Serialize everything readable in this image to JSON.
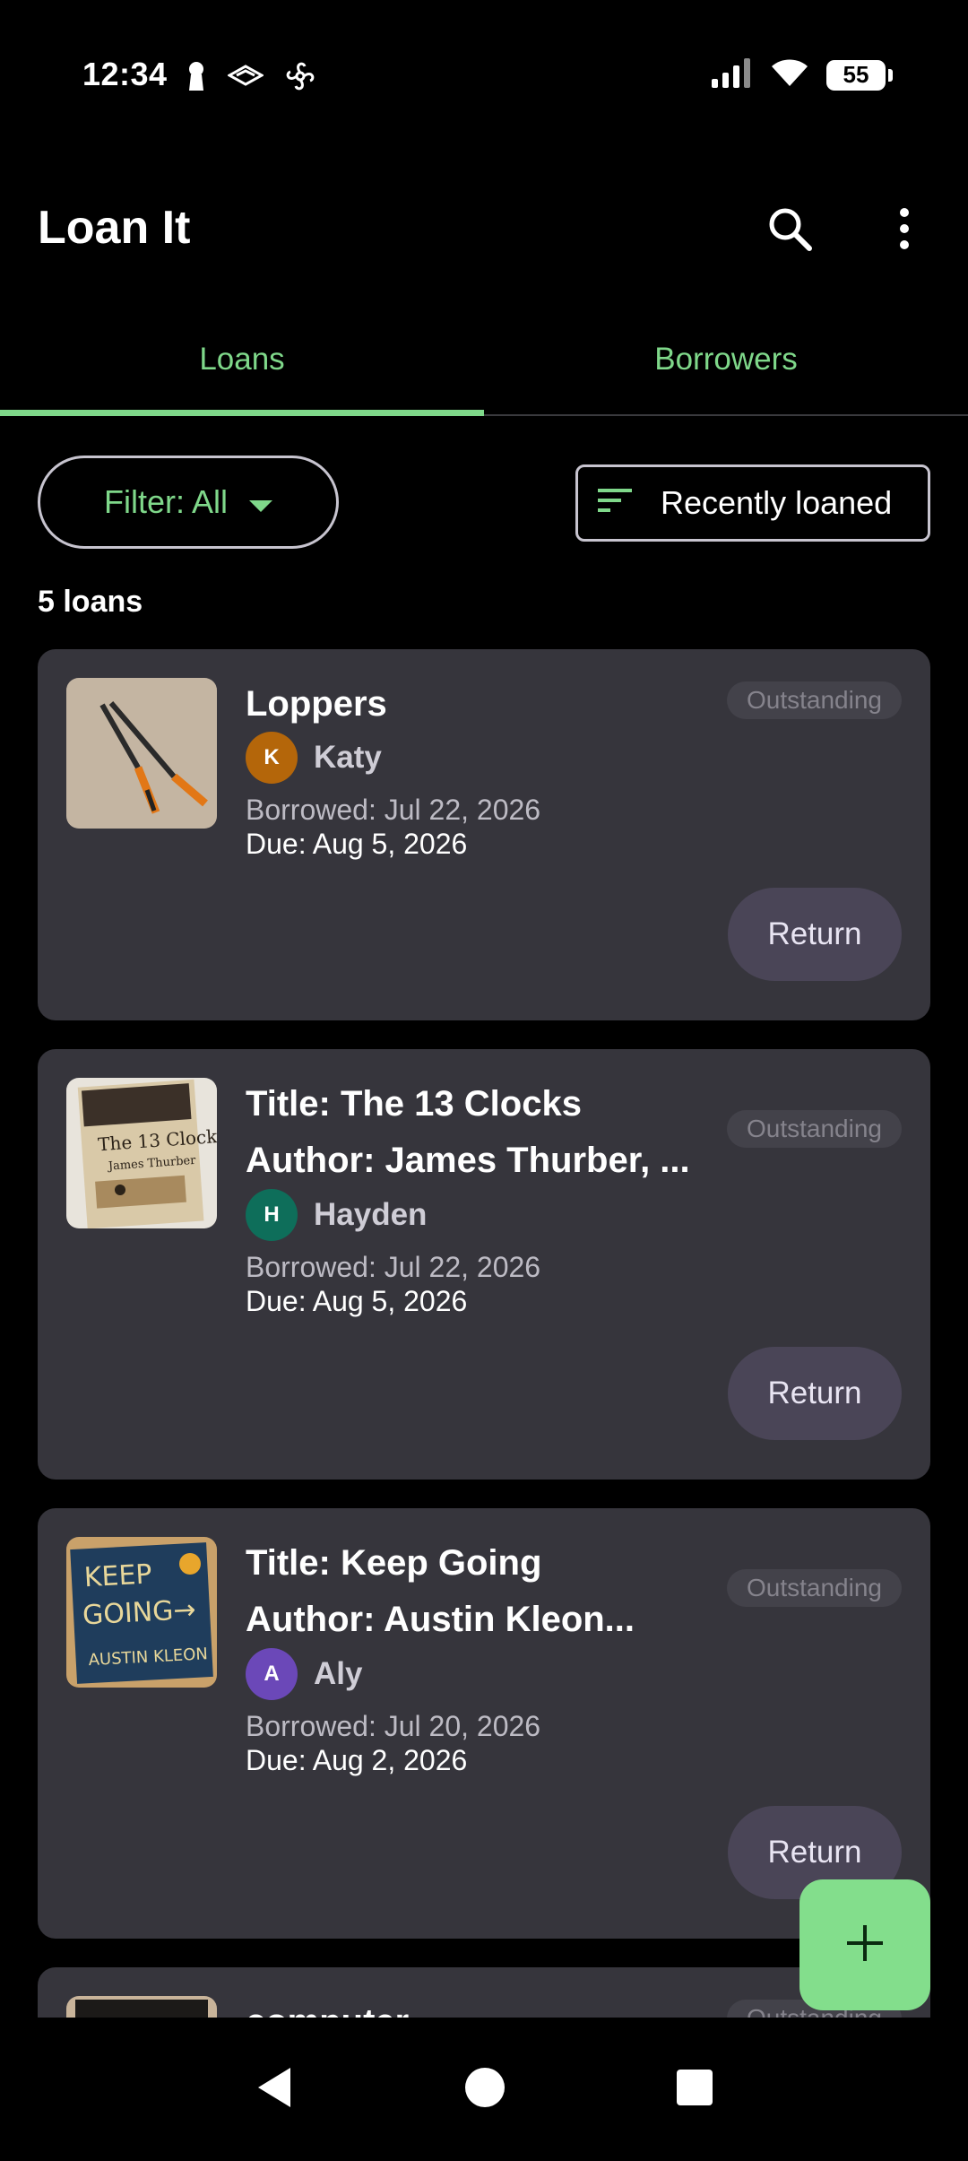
{
  "status_bar": {
    "time": "12:34",
    "battery": "55",
    "icons": [
      "keyhole-icon",
      "wireless-icon",
      "fan-icon",
      "signal-icon",
      "wifi-icon",
      "battery-icon"
    ]
  },
  "app_bar": {
    "title": "Loan It",
    "actions": [
      "search-icon",
      "more-vert-icon"
    ]
  },
  "tabs": [
    {
      "label": "Loans",
      "active": true
    },
    {
      "label": "Borrowers",
      "active": false
    }
  ],
  "filter": {
    "label": "Filter: All"
  },
  "sort": {
    "label": "Recently loaned"
  },
  "count_label": "5 loans",
  "loans": [
    {
      "title_lines": [
        "Loppers"
      ],
      "borrower": "Katy",
      "initial": "K",
      "avatar_color": "#b4660a",
      "borrowed": "Borrowed: Jul 22, 2026",
      "due": "Due: Aug 5, 2026",
      "status": "Outstanding",
      "action": "Return"
    },
    {
      "title_lines": [
        "Title: The 13 Clocks",
        "Author: James Thurber, ..."
      ],
      "borrower": "Hayden",
      "initial": "H",
      "avatar_color": "#0e6e5a",
      "borrowed": "Borrowed: Jul 22, 2026",
      "due": "Due: Aug 5, 2026",
      "status": "Outstanding",
      "action": "Return"
    },
    {
      "title_lines": [
        "Title: Keep Going",
        "Author: Austin Kleon..."
      ],
      "borrower": "Aly",
      "initial": "A",
      "avatar_color": "#6b48b8",
      "borrowed": "Borrowed: Jul 20, 2026",
      "due": "Due: Aug 2, 2026",
      "status": "Outstanding",
      "action": "Return"
    },
    {
      "title_lines": [
        "computer"
      ],
      "status": "Outstanding"
    }
  ],
  "colors": {
    "accent": "#7fd88a",
    "card": "#36353c",
    "fab": "#83de8c"
  }
}
